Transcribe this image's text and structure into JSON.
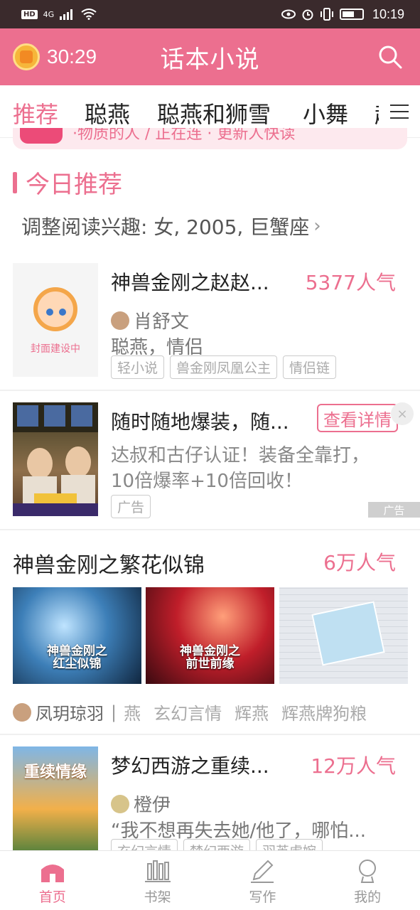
{
  "status_bar": {
    "network": "HD",
    "signal": "4G",
    "time": "10:19"
  },
  "app_bar": {
    "timer": "30:29",
    "title": "话本小说",
    "icons": [
      "coin-timer-icon",
      "search-icon"
    ]
  },
  "tabs": {
    "items": [
      "推荐",
      "聪燕",
      "聪燕和狮雪",
      "小舞",
      "起"
    ],
    "active_index": 0,
    "menu_icon": "hamburger-menu-icon"
  },
  "banner_peek": {
    "text": "·物质的人 / 正在连 · 更新人快读"
  },
  "section": {
    "title": "今日推荐",
    "interest_label": "调整阅读兴趣: 女, 2005, 巨蟹座",
    "chevron": "›"
  },
  "books": [
    {
      "title": "神兽金刚之赵赵...",
      "popularity": "5377人气",
      "author": "肖舒文",
      "desc": "聪燕，情侣",
      "cover_label": "封面建设中",
      "tags": [
        "轻小说",
        "兽金刚凤凰公主",
        "情侣链"
      ]
    }
  ],
  "ad": {
    "title": "随时随地爆装，随...",
    "cta": "查看详情",
    "close": "×",
    "desc_line1": "达叔和古仔认证！装备全靠打，",
    "desc_line2": "10倍爆率+10倍回收！",
    "tag": "广告",
    "badge": "广告"
  },
  "multi_cover_book": {
    "title": "神兽金刚之繁花似锦",
    "popularity": "6万人气",
    "covers": [
      {
        "caption": "神兽金刚之\n红尘似锦",
        "color": "#2a5a8c"
      },
      {
        "caption": "神兽金刚之\n前世前缘",
        "color": "#b8202a"
      },
      {
        "caption": "",
        "color": "#d8dde4"
      }
    ],
    "author": "凤玥琼羽",
    "separator": "|",
    "tags": [
      "燕",
      "玄幻言情",
      "辉燕",
      "辉燕牌狗粮"
    ]
  },
  "book2": {
    "title": "梦幻西游之重续...",
    "popularity": "12万人气",
    "author": "橙伊",
    "desc": "“我不想再失去她/他了，哪怕...",
    "cover_caption": "重续情缘",
    "tags": [
      "玄幻言情",
      "梦幻西游",
      "羽英虐婉"
    ]
  },
  "bottom_nav": {
    "items": [
      {
        "label": "首页",
        "icon": "home-icon"
      },
      {
        "label": "书架",
        "icon": "bookshelf-icon"
      },
      {
        "label": "写作",
        "icon": "pen-icon"
      },
      {
        "label": "我的",
        "icon": "profile-icon"
      }
    ],
    "active_index": 0
  },
  "colors": {
    "accent": "#ec6f8f",
    "status_bar": "#3a2a2c"
  }
}
